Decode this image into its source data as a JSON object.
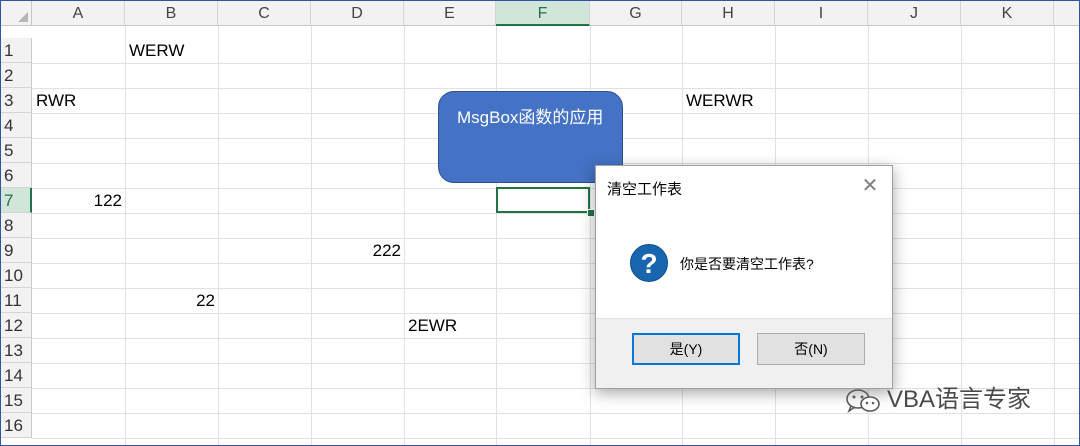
{
  "sheet": {
    "columns": [
      "A",
      "B",
      "C",
      "D",
      "E",
      "F",
      "G",
      "H",
      "I",
      "J",
      "K"
    ],
    "active_column": "F",
    "rows": [
      "1",
      "2",
      "3",
      "4",
      "5",
      "6",
      "7",
      "8",
      "9",
      "10",
      "11",
      "12",
      "13",
      "14",
      "15",
      "16"
    ],
    "active_row": "7",
    "cells": {
      "B1": "WERW",
      "A3": "RWR",
      "H3": "WERWR",
      "A7": "122",
      "D9": "222",
      "B11": "22",
      "E12": "2EWR"
    }
  },
  "callout": {
    "text": "MsgBox函数的应用"
  },
  "dialog": {
    "title": "清空工作表",
    "message": "你是否要清空工作表?",
    "icon": "question-icon",
    "yes_label": "是(Y)",
    "no_label": "否(N)",
    "close_glyph": "✕"
  },
  "watermark": {
    "text": "VBA语言专家",
    "icon": "wechat-icon"
  },
  "colors": {
    "accent_green": "#217346",
    "callout_fill": "#4472c4",
    "question_blue": "#1a65b0",
    "button_focus": "#0078d7"
  }
}
